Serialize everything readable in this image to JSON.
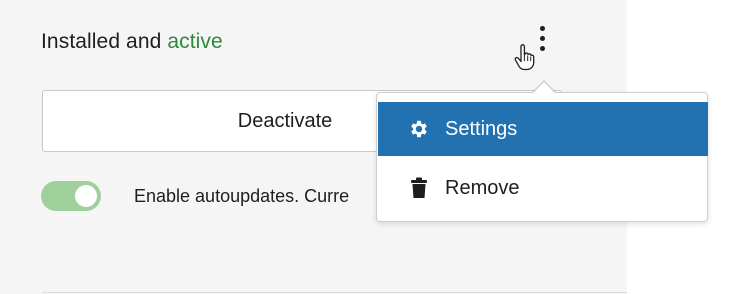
{
  "status": {
    "prefix": "Installed and",
    "state": "active"
  },
  "actions": {
    "deactivate_label": "Deactivate"
  },
  "autoupdates": {
    "enabled": true,
    "text": "Enable autoupdates. Curre"
  },
  "menu": {
    "items": [
      {
        "label": "Settings",
        "icon": "gear-icon",
        "highlighted": true
      },
      {
        "label": "Remove",
        "icon": "trash-icon",
        "highlighted": false
      }
    ]
  },
  "colors": {
    "active": "#2e8a38",
    "highlight": "#2271b1",
    "toggle_on": "#9fd09c"
  }
}
